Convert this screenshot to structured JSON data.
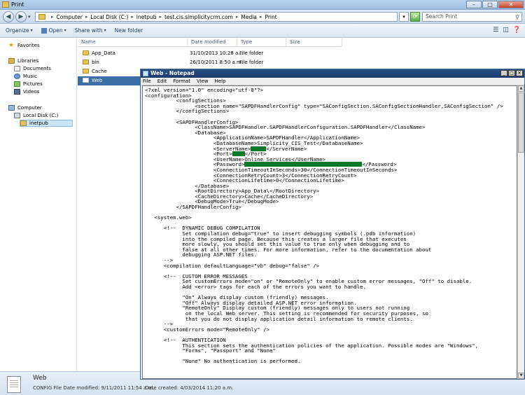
{
  "explorer": {
    "title": "Print",
    "breadcrumbs": [
      "Computer",
      "Local Disk (C:)",
      "inetpub",
      "test.cis.simplicitycrm.com",
      "Media",
      "Print"
    ],
    "search_placeholder": "Search Print",
    "toolbar": {
      "organize": "Organize",
      "open": "Open",
      "share_with": "Share with",
      "new_folder": "New folder"
    },
    "nav": {
      "favorites": "Favorites",
      "libraries": "Libraries",
      "documents": "Documents",
      "music": "Music",
      "pictures": "Pictures",
      "videos": "Videos",
      "computer": "Computer",
      "local_disk": "Local Disk (C:)",
      "inetpub": "inetpub"
    },
    "columns": {
      "name": "Name",
      "date_modified": "Date modified",
      "type": "Type",
      "size": "Size"
    },
    "files": [
      {
        "name": "App_Data",
        "date": "31/10/2013 10:28 a...",
        "type": "File folder"
      },
      {
        "name": "bin",
        "date": "26/10/2011 8:50 a.m.",
        "type": "File folder"
      },
      {
        "name": "Cache",
        "date": "",
        "type": ""
      },
      {
        "name": "Web",
        "date": "",
        "type": ""
      }
    ],
    "status": {
      "name": "Web",
      "type_date": "CONFIG File  Date modified: 9/11/2011 11:54 a.m.",
      "created": "Date created: 4/03/2014 11:20 a.m."
    }
  },
  "notepad": {
    "title": "Web - Notepad",
    "menu": [
      "File",
      "Edit",
      "Format",
      "View",
      "Help"
    ],
    "lines": {
      "l1": "<?xml version=\"1.0\" encoding=\"utf-8\"?>",
      "l2": "<configuration>",
      "l3": "          <configSections>",
      "l4": "                <section name=\"SAPDFHandlerConfig\" type=\"SAConfigSection.SAConfigSectionHandler,SAConfigSection\" />",
      "l5": "          </configSections>",
      "l7": "          <SAPDFHandlerConfig>",
      "l8": "                <ClassName>SAPDFHandler.SAPDFHandlerConfiguration.SAPDFHandler</ClassName>",
      "l9": "                <Database>",
      "l10": "                      <ApplicationName>SAPDFHandler</ApplicationName>",
      "l11": "                      <DatabaseName>Simplicity_CIS_Test</DatabaseName>",
      "l12a": "                      <ServerName>",
      "l12b": "</ServerName>",
      "l13a": "                      <Port>",
      "l13b": "</Port>",
      "l14": "                      <UserName>Online Services</UserName>",
      "l15a": "                      <Password>",
      "l15b": "</Password>",
      "l16": "                      <ConnectionTimeoutInSeconds>30</ConnectionTimeoutInSeconds>",
      "l17": "                      <ConnectionRetryCount>3</ConnectionRetryCount>",
      "l18": "                      <ConnectionLifetime>0</ConnectionLifetime>",
      "l19": "                </Database>",
      "l20": "                <RootDirectory>App_Data\\</RootDirectory>",
      "l21": "                <CacheDirectory>Cache</CacheDirectory>",
      "l22": "                <DebugMode>True</DebugMode>",
      "l23": "          </SAPDFHandlerConfig>",
      "l25": "   <system.web>",
      "l27": "      <!--  DYNAMIC DEBUG COMPILATION",
      "l28": "            Set compilation debug=\"true\" to insert debugging symbols (.pdb information)",
      "l29": "            into the compiled page. Because this creates a larger file that executes",
      "l30": "            more slowly, you should set this value to true only when debugging and to",
      "l31": "            false at all other times. For more information, refer to the documentation about",
      "l32": "            debugging ASP.NET files.",
      "l33": "      -->",
      "l34": "      <compilation defaultLanguage=\"vb\" debug=\"false\" />",
      "l36": "      <!--  CUSTOM ERROR MESSAGES",
      "l37": "            Set customErrors mode=\"on\" or \"RemoteOnly\" to enable custom error messages, \"Off\" to disable.",
      "l38": "            Add <error> tags for each of the errors you want to handle.",
      "l40": "            \"On\" Always display custom (friendly) messages.",
      "l41": "            \"Off\" Always display detailed ASP.NET error information.",
      "l42": "            \"RemoteOnly\" Display custom (friendly) messages only to users not running",
      "l43": "             on the local Web server. This setting is recommended for security purposes, so",
      "l44": "             that you do not display application detail information to remote clients.",
      "l45": "      -->",
      "l46": "      <customErrors mode=\"RemoteOnly\" />",
      "l48": "      <!--  AUTHENTICATION",
      "l49": "            This section sets the authentication policies of the application. Possible modes are \"Windows\",",
      "l50": "            \"Forms\", \"Passport\" and \"None\"",
      "l52": "            \"None\" No authentication is performed."
    }
  }
}
